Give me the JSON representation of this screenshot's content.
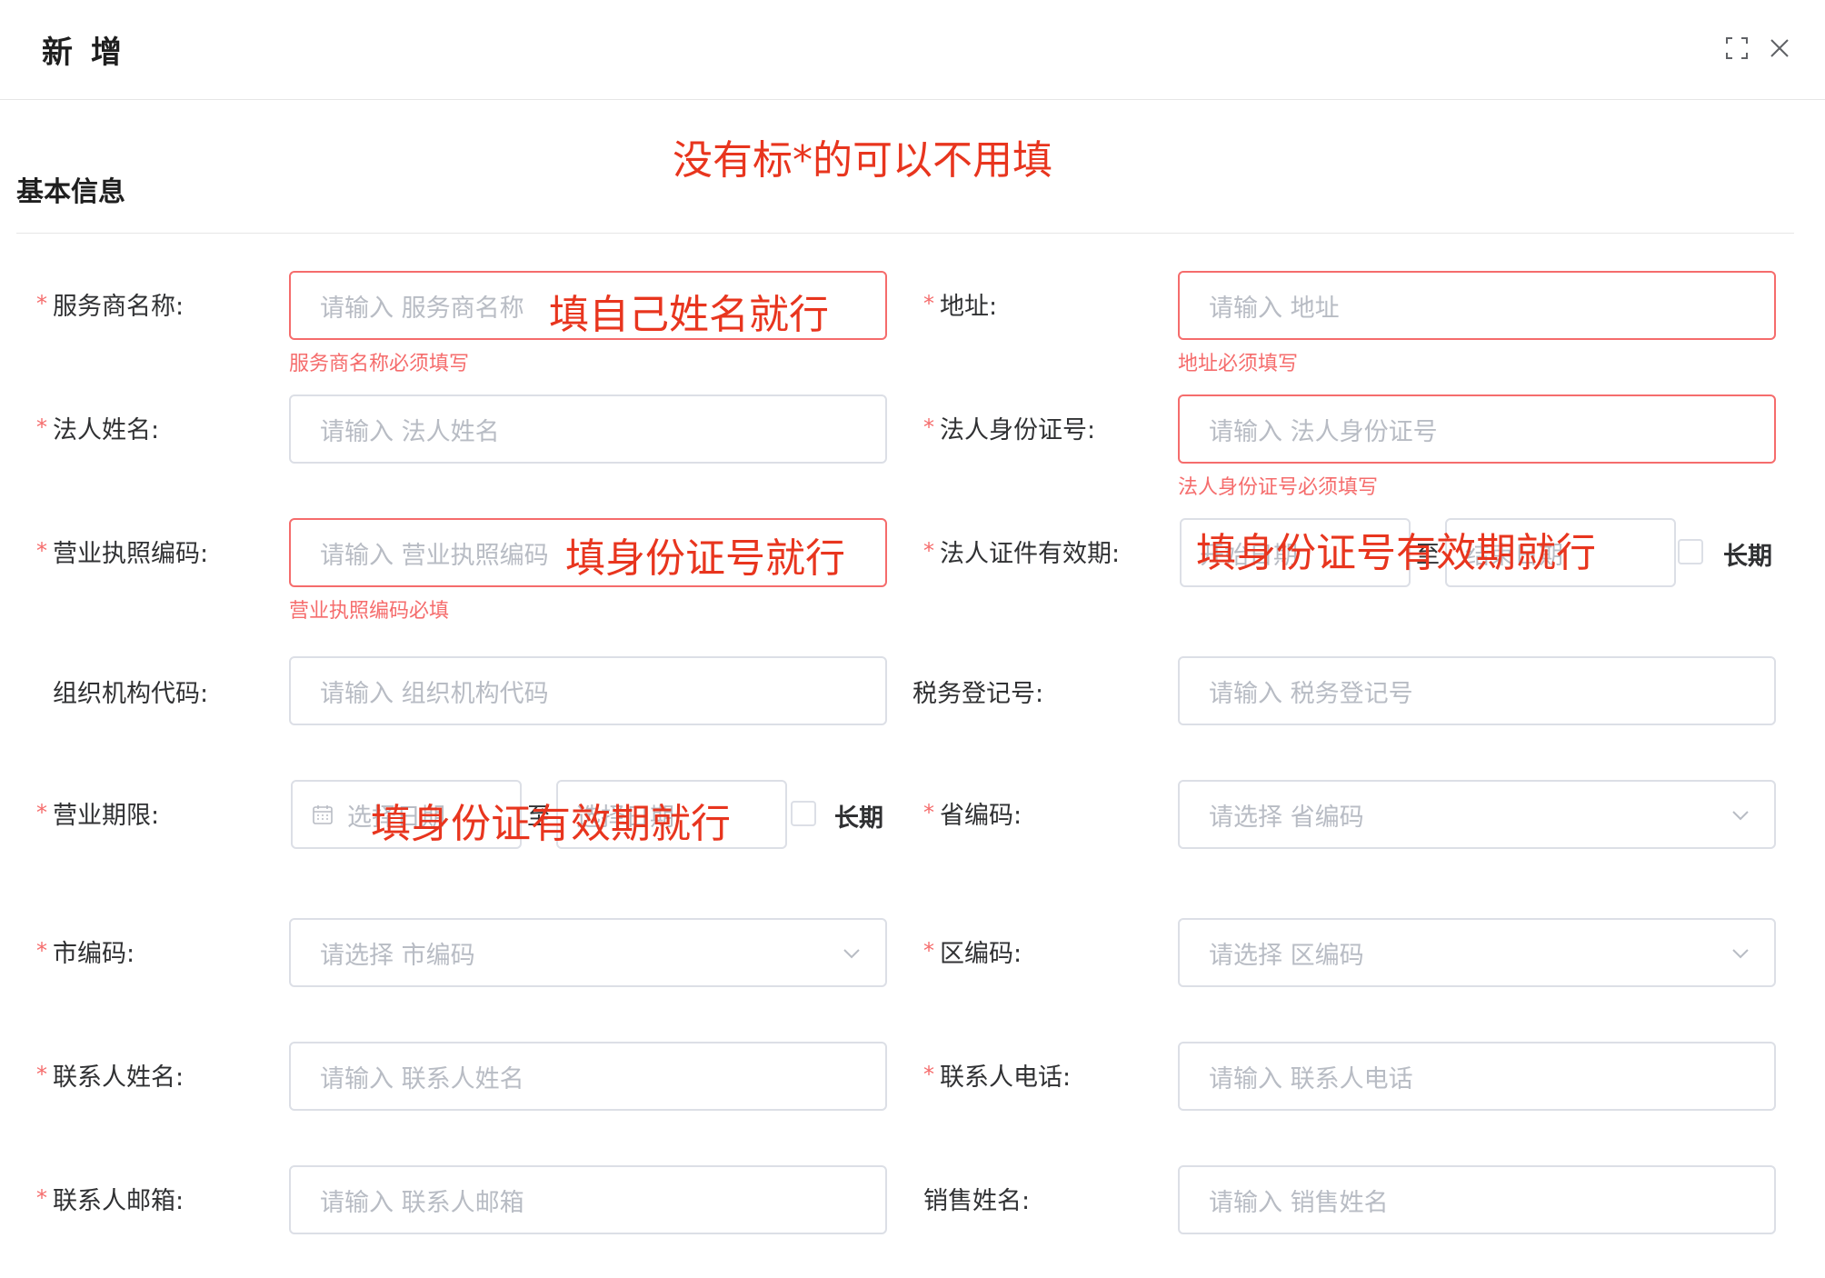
{
  "dialog": {
    "title": "新 增"
  },
  "annotations": {
    "top_note": "没有标*的可以不用填",
    "service_name_note": "填自己姓名就行",
    "license_code_note": "填身份证号就行",
    "legal_id_validity_note": "填身份证号有效期就行",
    "business_period_note": "填身份证有效期就行"
  },
  "section": {
    "title": "基本信息"
  },
  "form": {
    "service_name": {
      "required": "*",
      "label": "服务商名称:",
      "placeholder": "请输入 服务商名称",
      "error": "服务商名称必须填写"
    },
    "address": {
      "required": "*",
      "label": "地址:",
      "placeholder": "请输入 地址",
      "error": "地址必须填写"
    },
    "legal_name": {
      "required": "*",
      "label": "法人姓名:",
      "placeholder": "请输入 法人姓名"
    },
    "legal_id": {
      "required": "*",
      "label": "法人身份证号:",
      "placeholder": "请输入 法人身份证号",
      "error": "法人身份证号必须填写"
    },
    "license_code": {
      "required": "*",
      "label": "营业执照编码:",
      "placeholder": "请输入 营业执照编码",
      "error": "营业执照编码必填"
    },
    "legal_id_validity": {
      "required": "*",
      "label": "法人证件有效期:",
      "start_placeholder": "开始日期",
      "separator": "至",
      "end_placeholder": "结束日期",
      "long_term": "长期"
    },
    "org_code": {
      "label": "组织机构代码:",
      "placeholder": "请输入 组织机构代码"
    },
    "tax_no": {
      "label": "税务登记号:",
      "placeholder": "请输入 税务登记号"
    },
    "business_period": {
      "required": "*",
      "label": "营业期限:",
      "start_placeholder": "选择日期",
      "separator": "至",
      "end_placeholder": "选择日期",
      "long_term": "长期"
    },
    "province_code": {
      "required": "*",
      "label": "省编码:",
      "placeholder": "请选择 省编码"
    },
    "city_code": {
      "required": "*",
      "label": "市编码:",
      "placeholder": "请选择 市编码"
    },
    "district_code": {
      "required": "*",
      "label": "区编码:",
      "placeholder": "请选择 区编码"
    },
    "contact_name": {
      "required": "*",
      "label": "联系人姓名:",
      "placeholder": "请输入 联系人姓名"
    },
    "contact_phone": {
      "required": "*",
      "label": "联系人电话:",
      "placeholder": "请输入 联系人电话"
    },
    "contact_email": {
      "required": "*",
      "label": "联系人邮箱:",
      "placeholder": "请输入 联系人邮箱"
    },
    "sales_name": {
      "label": "销售姓名:",
      "placeholder": "请输入 销售姓名"
    }
  },
  "icons": {
    "fullscreen": "fullscreen-icon",
    "close": "close-icon",
    "chevron": "chevron-down-icon",
    "calendar": "calendar-icon"
  },
  "colors": {
    "required_star": "#f56c6c",
    "error": "#f56c6c",
    "annotation": "#e8351e",
    "border": "#dcdfe6",
    "placeholder": "#b8bcc4"
  }
}
